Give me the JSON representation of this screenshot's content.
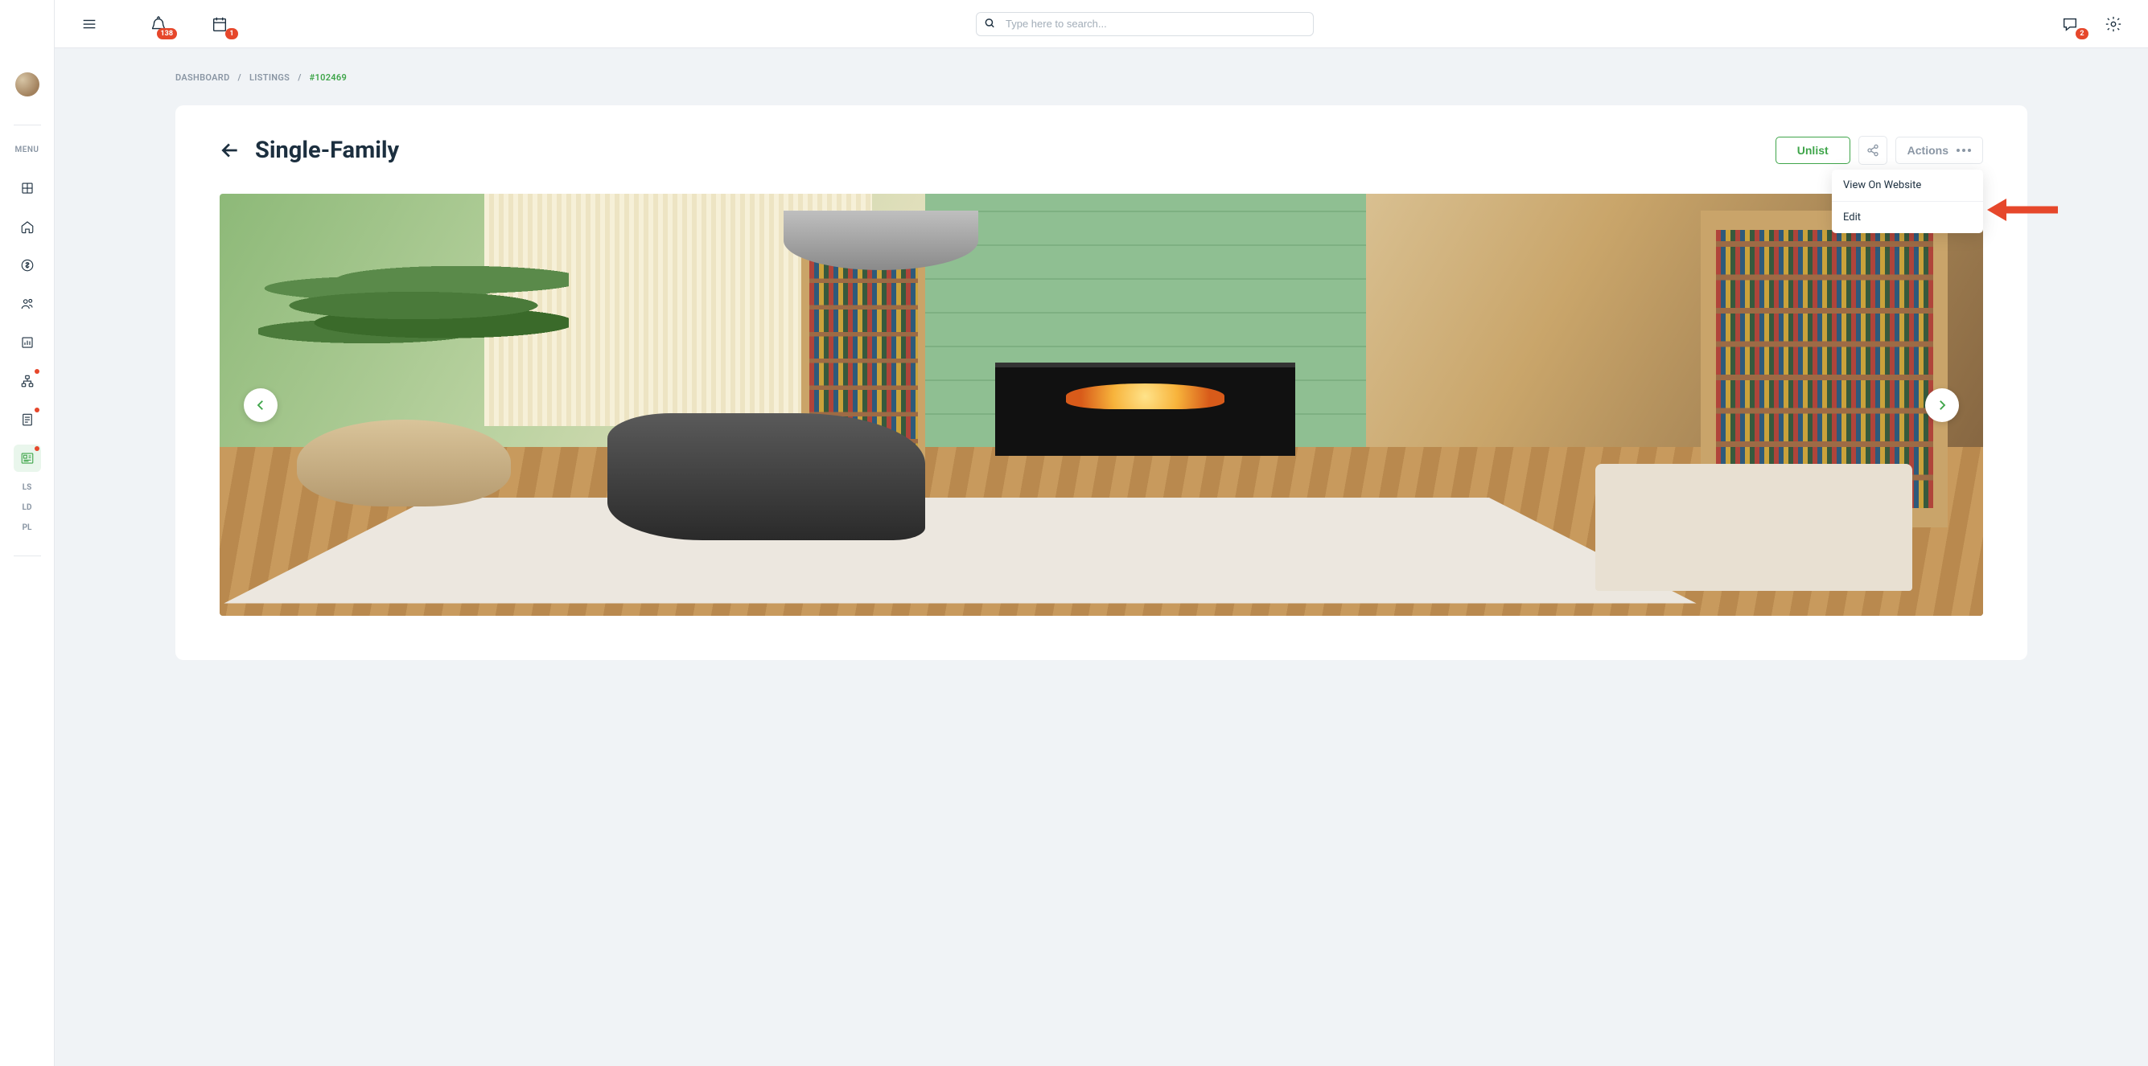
{
  "topbar": {
    "badges": {
      "alerts": "138",
      "calendar": "1",
      "chat": "2"
    },
    "search_placeholder": "Type here to search..."
  },
  "sidebar": {
    "menu_label": "MENU",
    "sub_items": [
      "LS",
      "LD",
      "PL"
    ]
  },
  "breadcrumbs": {
    "items": [
      "DASHBOARD",
      "LISTINGS"
    ],
    "current": "#102469",
    "sep": "/"
  },
  "header": {
    "title": "Single-Family",
    "unlist_label": "Unlist",
    "actions_label": "Actions"
  },
  "dropdown": {
    "items": [
      "View On Website",
      "Edit"
    ]
  }
}
